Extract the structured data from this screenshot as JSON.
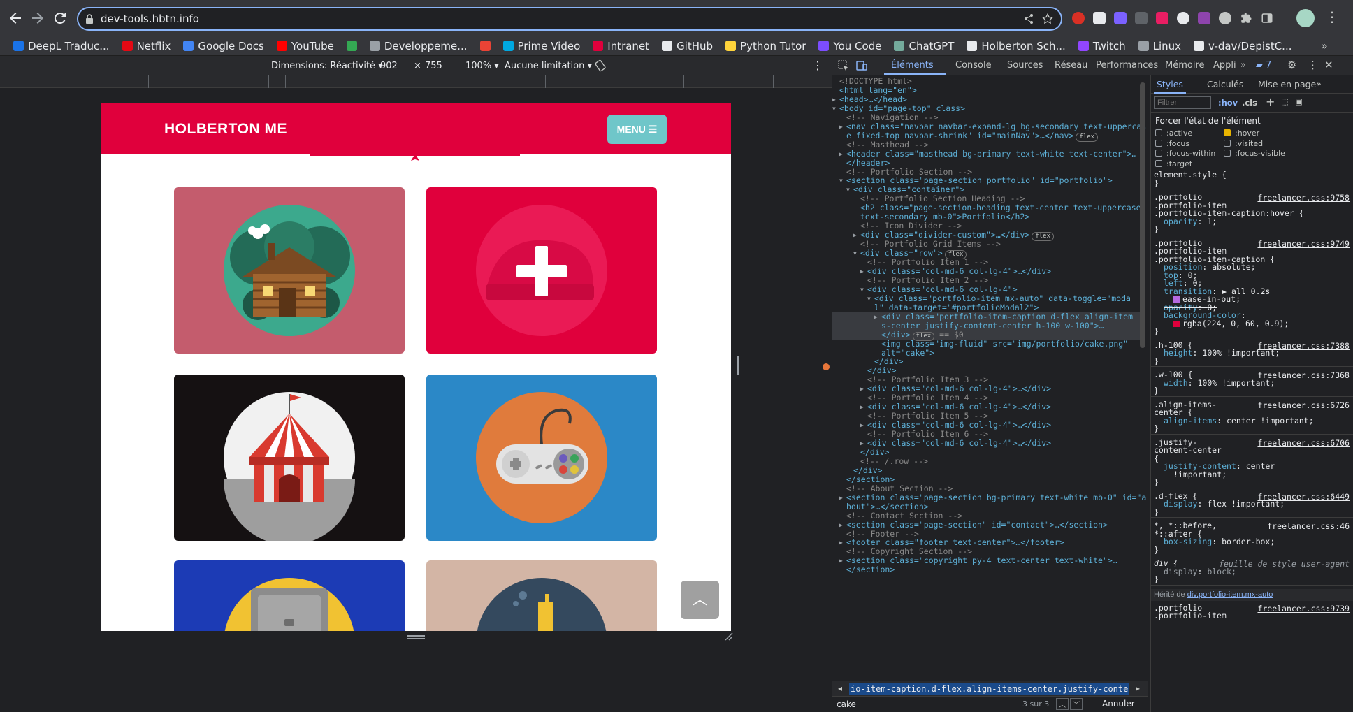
{
  "browser": {
    "url": "dev-tools.hbtn.info",
    "bookmarks": [
      "DeepL Traduc...",
      "Netflix",
      "Google Docs",
      "YouTube",
      "",
      "Developpeme...",
      "",
      "Prime Video",
      "Intranet",
      "GitHub",
      "Python Tutor",
      "You Code",
      "ChatGPT",
      "Holberton Sch...",
      "Twitch",
      "Linux",
      "v-dav/DepistC..."
    ],
    "bookmark_colors": [
      "#1a73e8",
      "#e50914",
      "#4285f4",
      "#ff0000",
      "#34a853",
      "#9aa0a6",
      "#ea4335",
      "#00a8e1",
      "#e0003c",
      "#e8eaed",
      "#ffd43b",
      "#7c4dff",
      "#74aa9c",
      "#e8eaed",
      "#9146ff",
      "#9aa0a6",
      "#e8eaed"
    ]
  },
  "device_toolbar": {
    "dimensions_label": "Dimensions: Réactivité",
    "width": "902",
    "times": "×",
    "height": "755",
    "zoom": "100%",
    "throttle": "Aucune limitation"
  },
  "site": {
    "brand": "HOLBERTON ME",
    "menu_label": "MENU",
    "cards": [
      {
        "bg": "#c45c6d",
        "icon": "cabin-icon"
      },
      {
        "bg": "#e0003c",
        "icon": "plus-icon"
      },
      {
        "bg": "#151112",
        "icon": "circus-tent-icon"
      },
      {
        "bg": "#2b88c7",
        "icon": "game-controller-icon"
      },
      {
        "bg": "#1c3bb5",
        "icon": "safe-icon"
      },
      {
        "bg": "#d3b5a5",
        "icon": "submarine-icon"
      }
    ],
    "accent_color": "#e0003c"
  },
  "devtools": {
    "tabs": [
      "Éléments",
      "Console",
      "Sources",
      "Réseau",
      "Performances",
      "Mémoire",
      "Appli"
    ],
    "issues_count": "7",
    "dom": [
      {
        "d": 0,
        "html": "<!DOCTYPE html>",
        "k": "cm"
      },
      {
        "d": 0,
        "html": "<html lang=\"en\">",
        "k": "tag"
      },
      {
        "d": 0,
        "arrow": "▶",
        "html": "<head>…</head>",
        "k": "tag"
      },
      {
        "d": 0,
        "arrow": "▼",
        "html": "<body id=\"page-top\" class>",
        "k": "tag"
      },
      {
        "d": 1,
        "html": "<!-- Navigation -->",
        "k": "cm"
      },
      {
        "d": 1,
        "arrow": "▶",
        "html": "<nav class=\"navbar navbar-expand-lg bg-secondary text-uppercas",
        "k": "tag"
      },
      {
        "d": 1,
        "html": "e fixed-top navbar-shrink\" id=\"mainNav\">…</nav>",
        "k": "tag",
        "pill": "flex"
      },
      {
        "d": 1,
        "html": "<!-- Masthead -->",
        "k": "cm"
      },
      {
        "d": 1,
        "arrow": "▶",
        "html": "<header class=\"masthead bg-primary text-white text-center\">…",
        "k": "tag"
      },
      {
        "d": 1,
        "html": "</header>",
        "k": "tag"
      },
      {
        "d": 1,
        "html": "<!-- Portfolio Section -->",
        "k": "cm"
      },
      {
        "d": 1,
        "arrow": "▼",
        "html": "<section class=\"page-section portfolio\" id=\"portfolio\">",
        "k": "tag"
      },
      {
        "d": 2,
        "arrow": "▼",
        "html": "<div class=\"container\">",
        "k": "tag"
      },
      {
        "d": 3,
        "html": "<!-- Portfolio Section Heading -->",
        "k": "cm"
      },
      {
        "d": 3,
        "html": "<h2 class=\"page-section-heading text-center text-uppercase",
        "k": "tag"
      },
      {
        "d": 3,
        "html": "text-secondary mb-0\">Portfolio</h2>",
        "k": "tag"
      },
      {
        "d": 3,
        "html": "<!-- Icon Divider -->",
        "k": "cm"
      },
      {
        "d": 3,
        "arrow": "▶",
        "html": "<div class=\"divider-custom\">…</div>",
        "k": "tag",
        "pill": "flex"
      },
      {
        "d": 3,
        "html": "<!-- Portfolio Grid Items -->",
        "k": "cm"
      },
      {
        "d": 3,
        "arrow": "▼",
        "html": "<div class=\"row\">",
        "k": "tag",
        "pill": "flex"
      },
      {
        "d": 4,
        "html": "<!-- Portfolio Item 1 -->",
        "k": "cm"
      },
      {
        "d": 4,
        "arrow": "▶",
        "html": "<div class=\"col-md-6 col-lg-4\">…</div>",
        "k": "tag"
      },
      {
        "d": 4,
        "html": "<!-- Portfolio Item 2 -->",
        "k": "cm"
      },
      {
        "d": 4,
        "arrow": "▼",
        "html": "<div class=\"col-md-6 col-lg-4\">",
        "k": "tag"
      },
      {
        "d": 5,
        "arrow": "▼",
        "html": "<div class=\"portfolio-item mx-auto\" data-toggle=\"moda",
        "k": "tag"
      },
      {
        "d": 5,
        "html": "l\" data-target=\"#portfolioModal2\">",
        "k": "tag"
      },
      {
        "d": 6,
        "arrow": "▶",
        "html": "<div class=\"portfolio-item-caption d-flex align-item",
        "k": "tag"
      },
      {
        "d": 6,
        "html": "s-center justify-content-center h-100 w-100\">…",
        "k": "tag"
      },
      {
        "d": 6,
        "html": "</div>",
        "k": "tag",
        "pill": "flex",
        "suffix": " == $0"
      },
      {
        "d": 6,
        "html": "<img class=\"img-fluid\" src=\"img/portfolio/cake.png\"",
        "k": "tag"
      },
      {
        "d": 6,
        "html": "alt=\"cake\">",
        "k": "tag"
      },
      {
        "d": 5,
        "html": "</div>",
        "k": "tag"
      },
      {
        "d": 4,
        "html": "</div>",
        "k": "tag"
      },
      {
        "d": 4,
        "html": "<!-- Portfolio Item 3 -->",
        "k": "cm"
      },
      {
        "d": 4,
        "arrow": "▶",
        "html": "<div class=\"col-md-6 col-lg-4\">…</div>",
        "k": "tag"
      },
      {
        "d": 4,
        "html": "<!-- Portfolio Item 4 -->",
        "k": "cm"
      },
      {
        "d": 4,
        "arrow": "▶",
        "html": "<div class=\"col-md-6 col-lg-4\">…</div>",
        "k": "tag"
      },
      {
        "d": 4,
        "html": "<!-- Portfolio Item 5 -->",
        "k": "cm"
      },
      {
        "d": 4,
        "arrow": "▶",
        "html": "<div class=\"col-md-6 col-lg-4\">…</div>",
        "k": "tag"
      },
      {
        "d": 4,
        "html": "<!-- Portfolio Item 6 -->",
        "k": "cm"
      },
      {
        "d": 4,
        "arrow": "▶",
        "html": "<div class=\"col-md-6 col-lg-4\">…</div>",
        "k": "tag"
      },
      {
        "d": 3,
        "html": "</div>",
        "k": "tag"
      },
      {
        "d": 3,
        "html": "<!-- /.row -->",
        "k": "cm"
      },
      {
        "d": 2,
        "html": "</div>",
        "k": "tag"
      },
      {
        "d": 1,
        "html": "</section>",
        "k": "tag"
      },
      {
        "d": 1,
        "html": "<!-- About Section -->",
        "k": "cm"
      },
      {
        "d": 1,
        "arrow": "▶",
        "html": "<section class=\"page-section bg-primary text-white mb-0\" id=\"a",
        "k": "tag"
      },
      {
        "d": 1,
        "html": "bout\">…</section>",
        "k": "tag"
      },
      {
        "d": 1,
        "html": "<!-- Contact Section -->",
        "k": "cm"
      },
      {
        "d": 1,
        "arrow": "▶",
        "html": "<section class=\"page-section\" id=\"contact\">…</section>",
        "k": "tag"
      },
      {
        "d": 1,
        "html": "<!-- Footer -->",
        "k": "cm"
      },
      {
        "d": 1,
        "arrow": "▶",
        "html": "<footer class=\"footer text-center\">…</footer>",
        "k": "tag"
      },
      {
        "d": 1,
        "html": "<!-- Copyright Section -->",
        "k": "cm"
      },
      {
        "d": 1,
        "arrow": "▶",
        "html": "<section class=\"copyright py-4 text-center text-white\">…",
        "k": "tag"
      },
      {
        "d": 1,
        "html": "</section>",
        "k": "tag"
      }
    ],
    "breadcrumb": "io-item-caption.d-flex.align-items-center.justify-content-center.h-100.w-100",
    "search_value": "cake",
    "search_count": "3 sur 3",
    "search_cancel": "Annuler",
    "styles_tabs": [
      "Styles",
      "Calculés",
      "Mise en page"
    ],
    "filter_placeholder": "Filtrer",
    "hov": ":hov",
    "cls": ".cls",
    "force_state_title": "Forcer l'état de l'élément",
    "states": [
      {
        "label": ":active",
        "checked": false
      },
      {
        "label": ":hover",
        "checked": true
      },
      {
        "label": ":focus",
        "checked": false
      },
      {
        "label": ":visited",
        "checked": false
      },
      {
        "label": ":focus-within",
        "checked": false
      },
      {
        "label": ":focus-visible",
        "checked": false
      },
      {
        "label": ":target",
        "checked": false
      }
    ],
    "element_style": "element.style {",
    "rules": [
      {
        "sel": [
          ".portfolio",
          ".portfolio-item",
          ".portfolio-item-caption:hover {"
        ],
        "src": "freelancer.css:9758",
        "props": [
          [
            "opacity",
            "1;"
          ]
        ]
      },
      {
        "sel": [
          ".portfolio",
          ".portfolio-item",
          ".portfolio-item-caption {"
        ],
        "src": "freelancer.css:9749",
        "props": [
          [
            "position",
            "absolute;"
          ],
          [
            "top",
            "0;"
          ],
          [
            "left",
            "0;"
          ],
          [
            "transition",
            "▶ all 0.2s"
          ],
          [
            "",
            "ease-in-out;"
          ],
          [
            "opacity",
            "0;"
          ],
          [
            "background-color",
            ""
          ],
          [
            "",
            "rgba(224, 0, 60, 0.9);"
          ]
        ]
      },
      {
        "sel": [
          ".h-100 {"
        ],
        "src": "freelancer.css:7388",
        "props": [
          [
            "height",
            "100% !important;"
          ]
        ]
      },
      {
        "sel": [
          ".w-100 {"
        ],
        "src": "freelancer.css:7368",
        "props": [
          [
            "width",
            "100% !important;"
          ]
        ]
      },
      {
        "sel": [
          ".align-items-",
          "center {"
        ],
        "src": "freelancer.css:6726",
        "props": [
          [
            "align-items",
            "center !important;"
          ]
        ]
      },
      {
        "sel": [
          ".justify-",
          "content-center",
          "{"
        ],
        "src": "freelancer.css:6706",
        "props": [
          [
            "justify-content",
            "center"
          ],
          [
            "",
            "!important;"
          ]
        ]
      },
      {
        "sel": [
          ".d-flex {"
        ],
        "src": "freelancer.css:6449",
        "props": [
          [
            "display",
            "flex !important;"
          ]
        ]
      },
      {
        "sel": [
          "*, *::before,",
          "*::after {"
        ],
        "src": "freelancer.css:46",
        "props": [
          [
            "box-sizing",
            "border-box;"
          ]
        ]
      },
      {
        "sel": [
          "div {"
        ],
        "src": "feuille de style user-agent",
        "props": [
          [
            "display",
            "block;"
          ]
        ]
      }
    ],
    "inherited_label": "Hérité de",
    "inherited_from": "div.portfolio-item.mx-auto",
    "last_rule": {
      "sel": [
        ".portfolio",
        ".portfolio-item"
      ],
      "src": "freelancer.css:9739"
    }
  }
}
